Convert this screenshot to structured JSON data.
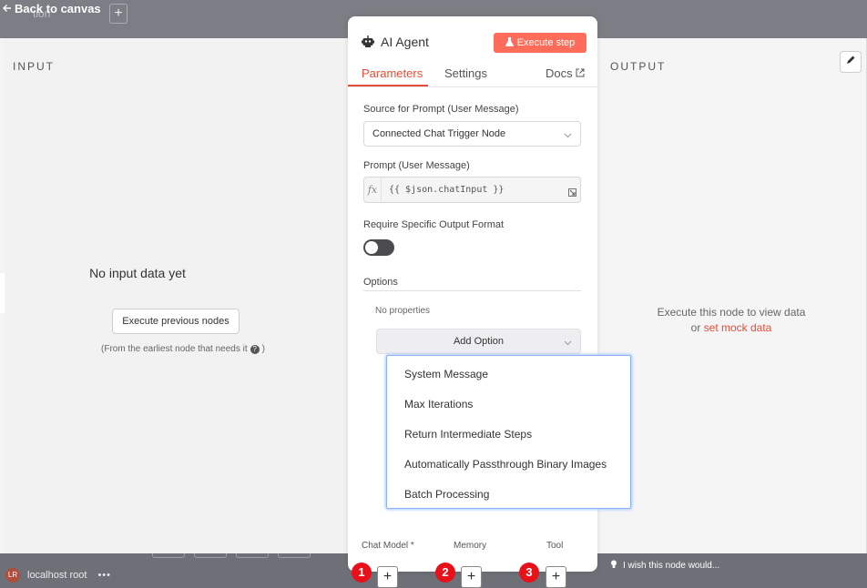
{
  "canvas": {
    "back_label": "Back to canvas",
    "ghost_text": "tion",
    "plus_tab": "+",
    "user_initials": "LR",
    "user_name": "localhost root",
    "user_more": "•••"
  },
  "input_panel": {
    "title": "INPUT",
    "empty_message": "No input data yet",
    "execute_previous_label": "Execute previous nodes",
    "hint": "(From the earliest node that needs it",
    "help_icon": "?",
    "hint_close": ")"
  },
  "output_panel": {
    "title": "OUTPUT",
    "message_line1": "Execute this node to view data",
    "message_or": "or ",
    "mock_link": "set mock data",
    "wish_text": "I wish this node would..."
  },
  "node": {
    "title": "AI Agent",
    "execute_step_label": "Execute step",
    "tabs": [
      {
        "label": "Parameters",
        "active": true
      },
      {
        "label": "Settings",
        "active": false
      },
      {
        "label": "Docs",
        "active": false
      }
    ],
    "source_label": "Source for Prompt (User Message)",
    "source_value": "Connected Chat Trigger Node",
    "prompt_label": "Prompt (User Message)",
    "prompt_fx": "fx",
    "prompt_value": "{{ $json.chatInput }}",
    "require_format_label": "Require Specific Output Format",
    "require_format_enabled": false,
    "options_label": "Options",
    "no_properties": "No properties",
    "add_option_label": "Add Option",
    "sub_nodes": [
      {
        "label": "Chat Model *",
        "badge": "1"
      },
      {
        "label": "Memory",
        "badge": "2"
      },
      {
        "label": "Tool",
        "badge": "3"
      }
    ],
    "plus_label": "+"
  },
  "option_menu": {
    "items": [
      "System Message",
      "Max Iterations",
      "Return Intermediate Steps",
      "Automatically Passthrough Binary Images",
      "Batch Processing"
    ]
  },
  "colors": {
    "accent": "#ea4b36",
    "execute_button": "#ff6d5a",
    "badge_red": "#e8111a",
    "menu_focus": "#8ab4f8"
  }
}
